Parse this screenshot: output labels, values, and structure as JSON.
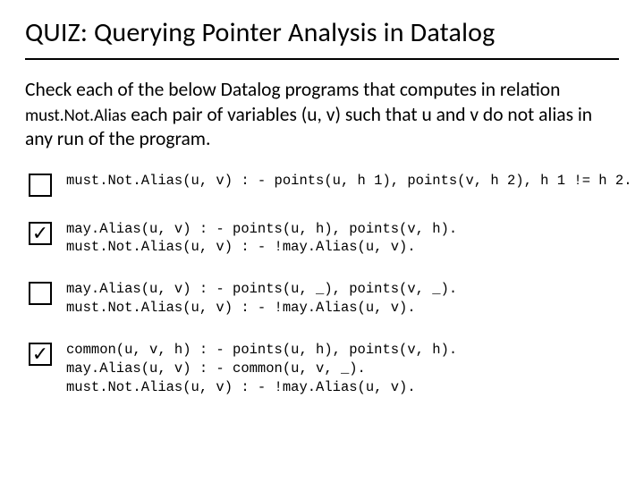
{
  "title": "QUIZ: Querying Pointer Analysis in Datalog",
  "instructions_pre": "Check each of the below Datalog programs that computes in relation ",
  "instructions_rel": "must.Not.Alias",
  "instructions_post": " each pair of variables (u, v) such that u and v do not alias in any run of the program.",
  "options": [
    {
      "checked": false,
      "code": "must.Not.Alias(u, v) : - points(u, h 1), points(v, h 2), h 1 != h 2."
    },
    {
      "checked": true,
      "code": "may.Alias(u, v) : - points(u, h), points(v, h).\nmust.Not.Alias(u, v) : - !may.Alias(u, v)."
    },
    {
      "checked": false,
      "code": "may.Alias(u, v) : - points(u, _), points(v, _).\nmust.Not.Alias(u, v) : - !may.Alias(u, v)."
    },
    {
      "checked": true,
      "code": "common(u, v, h) : - points(u, h), points(v, h).\nmay.Alias(u, v) : - common(u, v, _).\nmust.Not.Alias(u, v) : - !may.Alias(u, v)."
    }
  ],
  "checkmark": "✓"
}
